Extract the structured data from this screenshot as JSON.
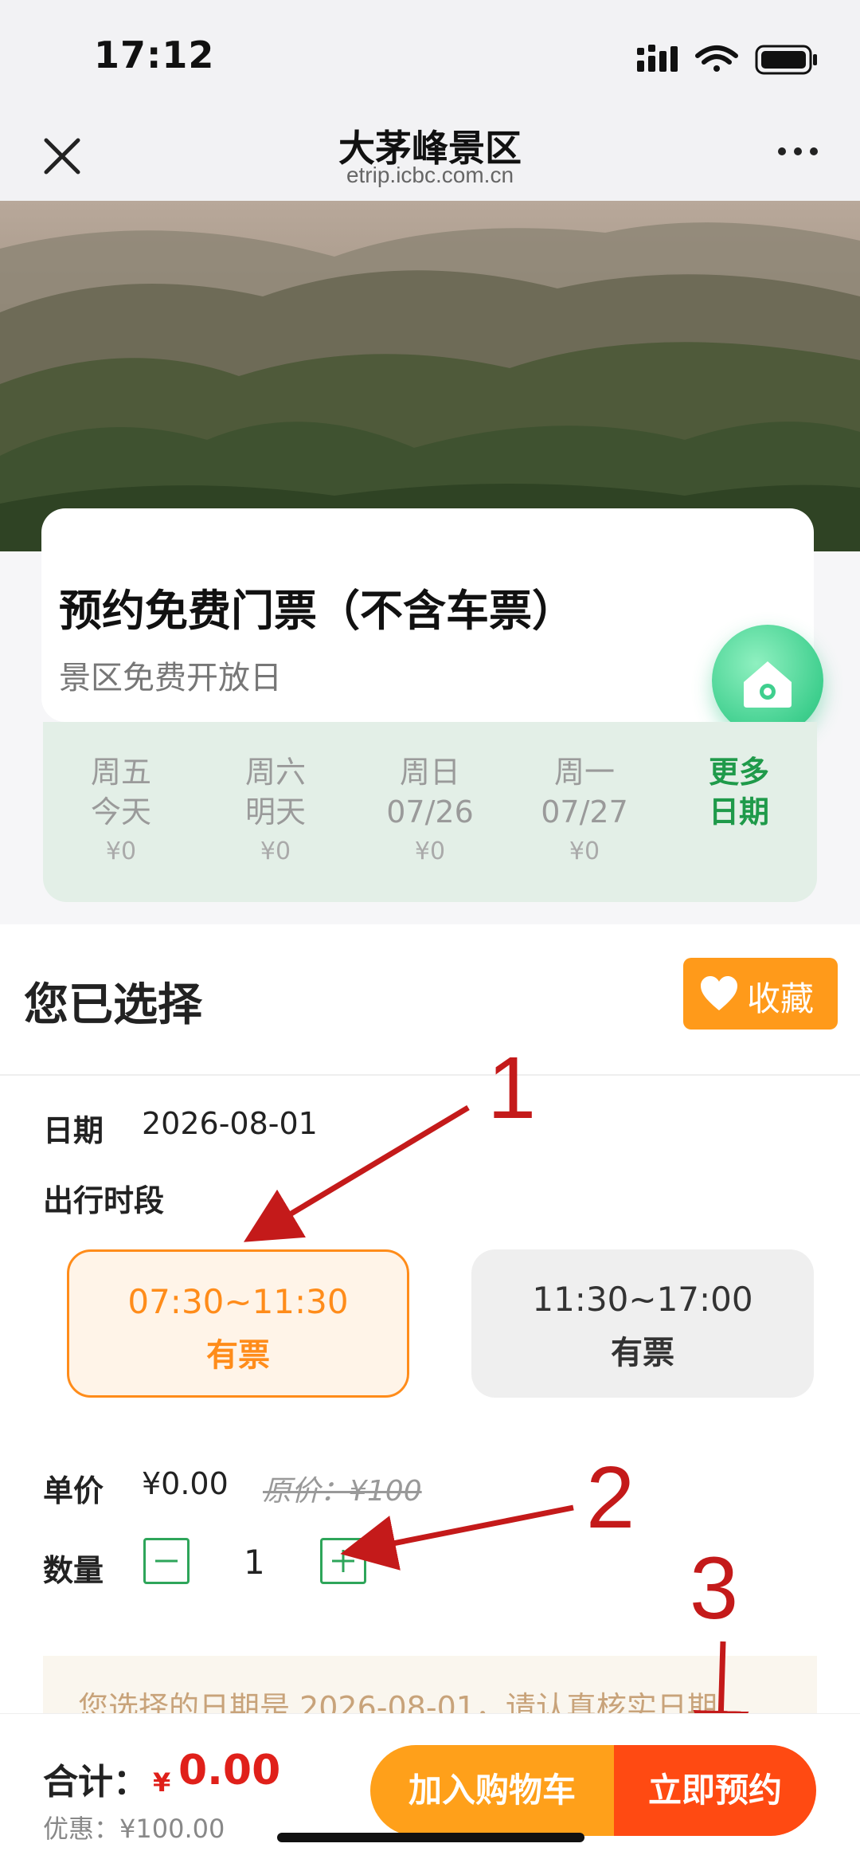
{
  "status_bar": {
    "time": "17:12"
  },
  "nav": {
    "title": "大茅峰景区",
    "subtitle": "etrip.icbc.com.cn"
  },
  "ticket": {
    "title": "预约免费门票（不含车票）",
    "subtitle": "景区免费开放日"
  },
  "dates": [
    {
      "line1": "周五",
      "line2": "今天",
      "price": "¥0"
    },
    {
      "line1": "周六",
      "line2": "明天",
      "price": "¥0"
    },
    {
      "line1": "周日",
      "line2": "07/26",
      "price": "¥0"
    },
    {
      "line1": "周一",
      "line2": "07/27",
      "price": "¥0"
    }
  ],
  "more_dates": {
    "line1": "更多",
    "line2": "日期"
  },
  "selection": {
    "title": "您已选择",
    "favorite_label": "收藏",
    "date_label": "日期",
    "date_value": "2026-08-01",
    "slot_label": "出行时段",
    "slots": [
      {
        "time": "07:30~11:30",
        "status": "有票",
        "selected": true
      },
      {
        "time": "11:30~17:00",
        "status": "有票",
        "selected": false
      }
    ],
    "price_label": "单价",
    "price_value": "¥0.00",
    "original_price": "原价：¥100",
    "qty_label": "数量",
    "qty_value": "1",
    "notice": "您选择的日期是 2026-08-01，请认真核实日期"
  },
  "footer": {
    "total_label": "合计：",
    "currency": "¥",
    "total_value": "0.00",
    "discount": "优惠：¥100.00",
    "cart_label": "加入购物车",
    "book_label": "立即预约"
  },
  "annotations": [
    "1",
    "2",
    "3"
  ],
  "colors": {
    "accent_orange": "#ff8c1a",
    "book_red": "#ff4a12",
    "price_red": "#e0201a",
    "green": "#2ea55a",
    "annotation_red": "#c41a1a"
  }
}
